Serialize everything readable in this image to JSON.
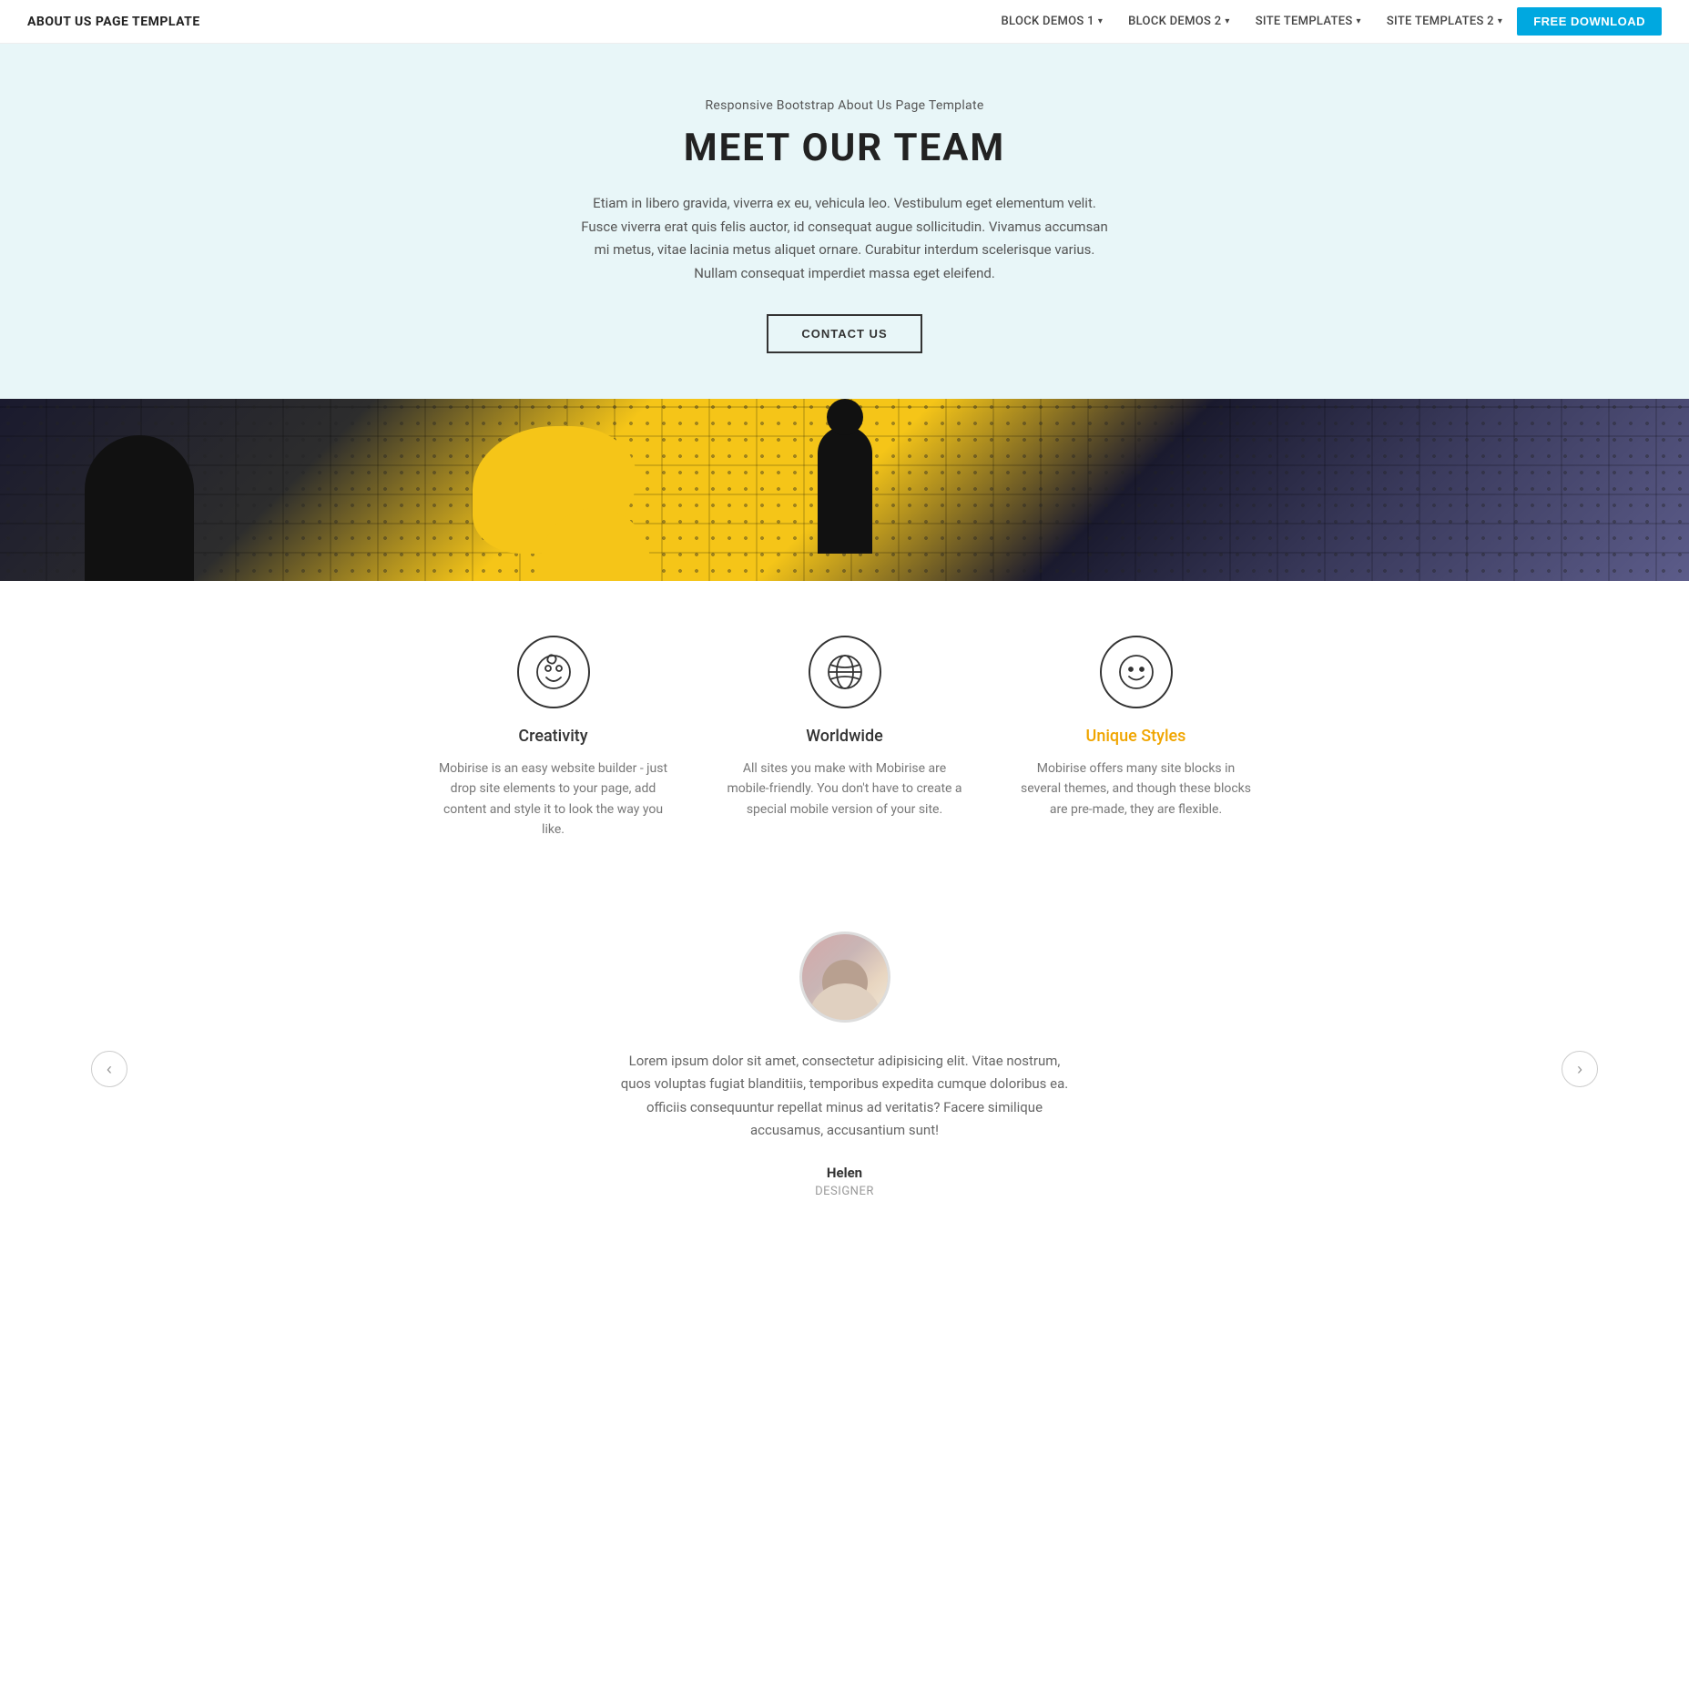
{
  "navbar": {
    "brand": "ABOUT US PAGE TEMPLATE",
    "items": [
      {
        "id": "block-demos-1",
        "label": "BLOCK DEMOS 1",
        "hasDropdown": true
      },
      {
        "id": "block-demos-2",
        "label": "BLOCK DEMOS 2",
        "hasDropdown": true
      },
      {
        "id": "site-templates",
        "label": "SITE TEMPLATES",
        "hasDropdown": true
      },
      {
        "id": "site-templates-2",
        "label": "SITE TEMPLATES 2",
        "hasDropdown": true
      }
    ],
    "cta": "FREE DOWNLOAD"
  },
  "meet_section": {
    "subtitle": "Responsive Bootstrap About Us Page Template",
    "title": "MEET OUR TEAM",
    "body": "Etiam in libero gravida, viverra ex eu, vehicula leo. Vestibulum eget elementum velit. Fusce viverra erat quis felis auctor, id consequat augue sollicitudin. Vivamus accumsan mi metus, vitae lacinia metus aliquet ornare. Curabitur interdum scelerisque varius. Nullam consequat imperdiet massa eget eleifend.",
    "cta": "CONTACT US"
  },
  "features": [
    {
      "id": "creativity",
      "icon": "creativity",
      "title": "Creativity",
      "title_color": "#333",
      "description": "Mobirise is an easy website builder - just drop site elements to your page, add content and style it to look the way you like."
    },
    {
      "id": "worldwide",
      "icon": "worldwide",
      "title": "Worldwide",
      "title_color": "#333",
      "description": "All sites you make with Mobirise are mobile-friendly. You don't have to create a special mobile version of your site."
    },
    {
      "id": "unique-styles",
      "icon": "smiley",
      "title": "Unique Styles",
      "title_color": "#f0a500",
      "description": "Mobirise offers many site blocks in several themes, and though these blocks are pre-made, they are flexible."
    }
  ],
  "testimonial": {
    "text": "Lorem ipsum dolor sit amet, consectetur adipisicing elit. Vitae nostrum, quos voluptas fugiat blanditiis, temporibus expedita cumque doloribus ea. officiis consequuntur repellat minus ad veritatis? Facere similique accusamus, accusantium sunt!",
    "name": "Helen",
    "role": "DESIGNER",
    "prev_label": "‹",
    "next_label": "›"
  }
}
